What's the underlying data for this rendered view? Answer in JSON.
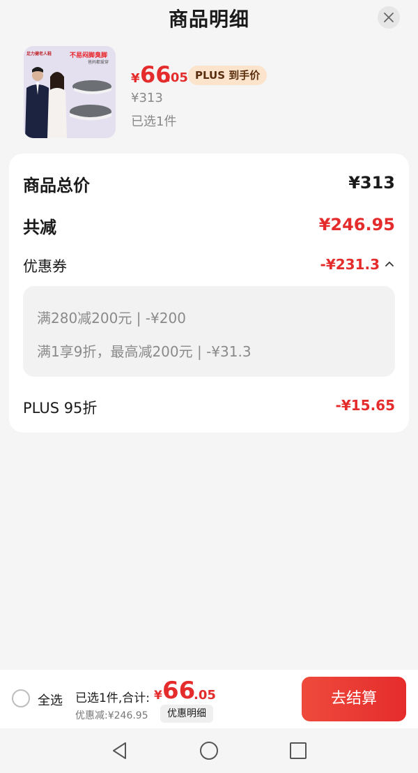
{
  "header": {
    "title": "商品明细",
    "close_icon": "close-icon"
  },
  "product": {
    "thumbnail": {
      "brand_text": "足力健老人鞋",
      "slogan": "不易闷脚臭脚",
      "sub": "爸妈都爱穿"
    },
    "price_yen": "¥",
    "price_int": "66",
    "price_dec": ".05",
    "plus_badge": "PLUS 到手价",
    "original_price": "¥313",
    "selected_count": "已选1件"
  },
  "breakdown": {
    "total_label": "商品总价",
    "total_value": "¥313",
    "reduce_label": "共减",
    "reduce_value": "¥246.95",
    "coupon_label": "优惠券",
    "coupon_value": "-¥231.3",
    "coupon_items": [
      "满280减200元 | -¥200",
      "满1享9折，最高减200元 | -¥31.3"
    ],
    "plus_label": "PLUS 95折",
    "plus_value": "-¥15.65"
  },
  "bottom": {
    "select_all": "全选",
    "sum_text": "已选1件,合计:",
    "sum_yen": "¥",
    "sum_int": "66",
    "sum_dec": ".05",
    "discount_text": "优惠减:¥246.95",
    "detail_button": "优惠明细",
    "checkout_button": "去结算"
  },
  "colors": {
    "accent_red": "#e52c2c",
    "plus_badge_bg": "#fbe3cc",
    "background": "#f5f5f5"
  }
}
